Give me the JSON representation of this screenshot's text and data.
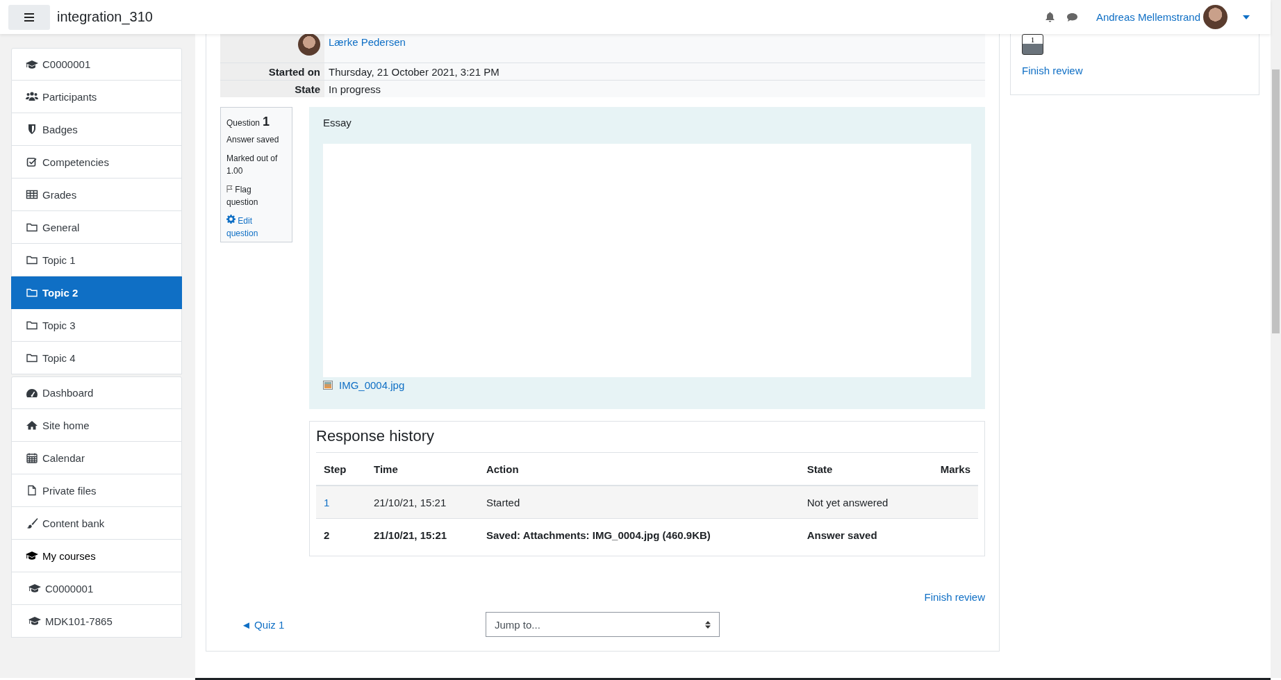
{
  "header": {
    "site_name": "integration_310",
    "user_name": "Andreas Mellemstrand"
  },
  "sidebar": {
    "groups": [
      {
        "items": [
          {
            "label": "C0000001",
            "kind": "course",
            "selected": false
          },
          {
            "label": "Participants",
            "kind": "participants",
            "selected": false
          },
          {
            "label": "Badges",
            "kind": "badges",
            "selected": false
          },
          {
            "label": "Competencies",
            "kind": "competencies",
            "selected": false
          },
          {
            "label": "Grades",
            "kind": "grades",
            "selected": false
          },
          {
            "label": "General",
            "kind": "section",
            "selected": false
          },
          {
            "label": "Topic 1",
            "kind": "section",
            "selected": false
          },
          {
            "label": "Topic 2",
            "kind": "section",
            "selected": true
          },
          {
            "label": "Topic 3",
            "kind": "section",
            "selected": false
          },
          {
            "label": "Topic 4",
            "kind": "section",
            "selected": false
          }
        ]
      },
      {
        "items": [
          {
            "label": "Dashboard",
            "kind": "dashboard",
            "selected": false
          },
          {
            "label": "Site home",
            "kind": "home",
            "selected": false
          },
          {
            "label": "Calendar",
            "kind": "calendar",
            "selected": false
          },
          {
            "label": "Private files",
            "kind": "files",
            "selected": false
          },
          {
            "label": "Content bank",
            "kind": "contentbank",
            "selected": false
          },
          {
            "label": "My courses",
            "kind": "heading",
            "selected": false
          },
          {
            "label": "C0000001",
            "kind": "subcourse",
            "selected": false
          },
          {
            "label": "MDK101-7865",
            "kind": "subcourse",
            "selected": false
          }
        ]
      }
    ]
  },
  "attempt_summary": {
    "rows": [
      {
        "kind": "user",
        "value": "Lærke Pedersen"
      },
      {
        "kind": "text",
        "label": "Started on",
        "value": "Thursday, 21 October 2021, 3:21 PM"
      },
      {
        "kind": "text",
        "label": "State",
        "value": "In progress"
      }
    ]
  },
  "question_info": {
    "label": "Question",
    "number": "1",
    "status": "Answer saved",
    "marked": "Marked out of 1.00",
    "flag": "Flag question",
    "edit": "Edit question"
  },
  "question": {
    "qtype": "Essay",
    "attachment": "IMG_0004.jpg"
  },
  "response_history": {
    "title": "Response history",
    "columns": [
      "Step",
      "Time",
      "Action",
      "State",
      "Marks"
    ],
    "rows": [
      {
        "current": false,
        "cells": [
          "1",
          "21/10/21, 15:21",
          "Started",
          "Not yet answered"
        ]
      },
      {
        "current": true,
        "cells": [
          "2",
          "21/10/21, 15:21",
          "Saved: Attachments: IMG_0004.jpg (460.9KB)",
          "Answer saved"
        ]
      }
    ]
  },
  "finish_review": "Finish review",
  "prev_link": "◄ Quiz 1",
  "jump_select": {
    "value": "Jump to..."
  },
  "quiz_nav": {
    "buttons": [
      {
        "label": "1"
      }
    ],
    "finish_link": "Finish review"
  }
}
